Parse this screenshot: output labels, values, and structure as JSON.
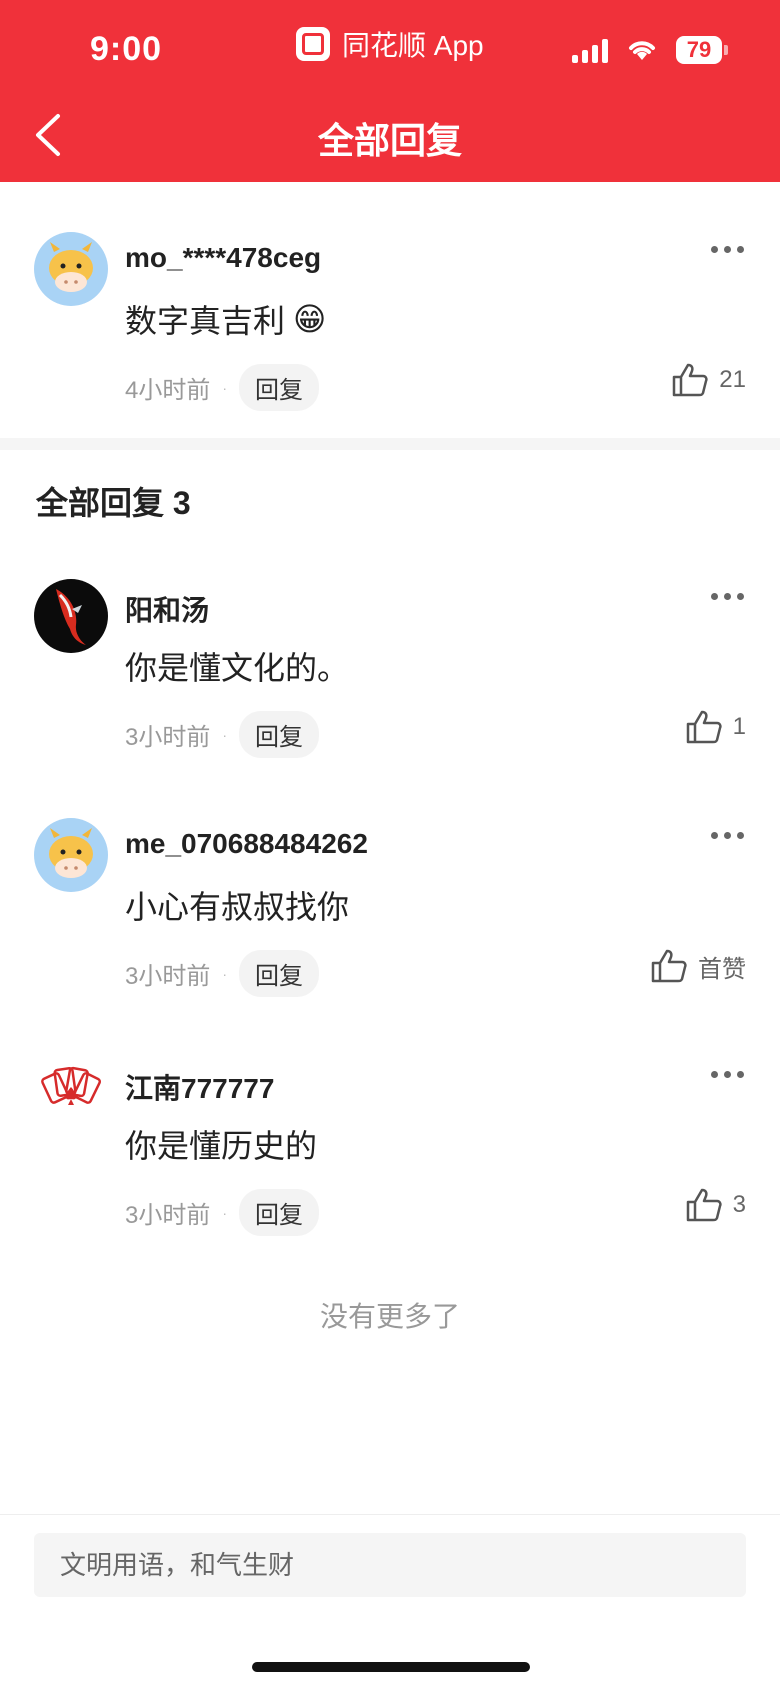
{
  "status_bar": {
    "time": "9:00",
    "app_name": "同花顺 App",
    "battery": "79"
  },
  "header": {
    "title": "全部回复"
  },
  "main_comment": {
    "username": "mo_****478ceg",
    "text": "数字真吉利",
    "emoji": "😁",
    "time": "4小时前",
    "reply_label": "回复",
    "likes": "21"
  },
  "replies_section": {
    "title": "全部回复 3"
  },
  "replies": [
    {
      "username": "阳和汤",
      "text": "你是懂文化的。",
      "time": "3小时前",
      "reply_label": "回复",
      "likes": "1"
    },
    {
      "username": "me_070688484262",
      "text": "小心有叔叔找你",
      "time": "3小时前",
      "reply_label": "回复",
      "likes": "首赞"
    },
    {
      "username": "江南777777",
      "text": "你是懂历史的",
      "time": "3小时前",
      "reply_label": "回复",
      "likes": "3"
    }
  ],
  "meta_separator": "·",
  "footer_text": "没有更多了",
  "input": {
    "placeholder": "文明用语，和气生财"
  },
  "colors": {
    "brand_red": "#f0313a",
    "avatar_blue": "#a9d3f5",
    "cow_yellow": "#f7c24a"
  }
}
